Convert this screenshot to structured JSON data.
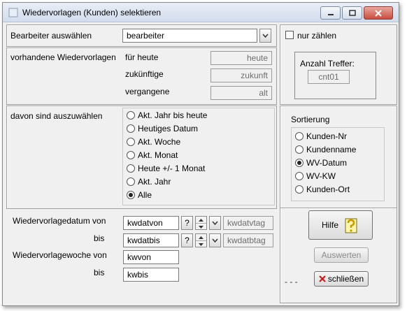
{
  "window": {
    "title": "Wiedervorlagen (Kunden) selektieren"
  },
  "bearbeiter": {
    "label": "Bearbeiter auswählen",
    "value": "bearbeiter"
  },
  "nur_zaehlen": {
    "label": "nur zählen",
    "checked": false
  },
  "vorhanden": {
    "label": "vorhandene Wiedervorlagen",
    "rows": [
      {
        "label": "für heute",
        "value": "heute"
      },
      {
        "label": "zukünftige",
        "value": "zukunft"
      },
      {
        "label": "vergangene",
        "value": "alt"
      }
    ]
  },
  "anzahl": {
    "label": "Anzahl Treffer:",
    "value": "cnt01"
  },
  "auswahl": {
    "label": "davon sind auszuwählen",
    "options": [
      {
        "label": "Akt. Jahr bis heute",
        "selected": false
      },
      {
        "label": "Heutiges Datum",
        "selected": false
      },
      {
        "label": "Akt. Woche",
        "selected": false
      },
      {
        "label": "Akt. Monat",
        "selected": false
      },
      {
        "label": "Heute +/- 1 Monat",
        "selected": false
      },
      {
        "label": "Akt. Jahr",
        "selected": false
      },
      {
        "label": "Alle",
        "selected": true
      }
    ]
  },
  "sortierung": {
    "label": "Sortierung",
    "options": [
      {
        "label": "Kunden-Nr",
        "selected": false
      },
      {
        "label": "Kundenname",
        "selected": false
      },
      {
        "label": "WV-Datum",
        "selected": true
      },
      {
        "label": "WV-KW",
        "selected": false
      },
      {
        "label": "Kunden-Ort",
        "selected": false
      }
    ]
  },
  "datum": {
    "von_label": "Wiedervorlagedatum von",
    "bis_label": "bis",
    "von_value": "kwdatvon",
    "bis_value": "kwdatbis",
    "von_tag": "kwdatvtag",
    "bis_tag": "kwdatbtag",
    "help_label": "?"
  },
  "woche": {
    "von_label": "Wiedervorlagewoche von",
    "bis_label": "bis",
    "von_value": "kwvon",
    "bis_value": "kwbis"
  },
  "buttons": {
    "hilfe": "Hilfe",
    "auswerten": "Auswerten",
    "schliessen": "schließen",
    "dashes": "- - -"
  }
}
